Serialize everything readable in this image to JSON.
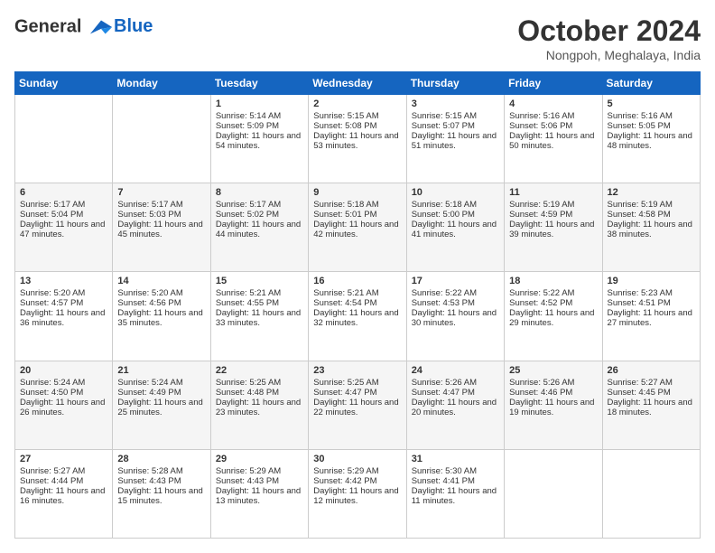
{
  "header": {
    "logo_line1": "General",
    "logo_line2": "Blue",
    "month": "October 2024",
    "location": "Nongpoh, Meghalaya, India"
  },
  "weekdays": [
    "Sunday",
    "Monday",
    "Tuesday",
    "Wednesday",
    "Thursday",
    "Friday",
    "Saturday"
  ],
  "weeks": [
    [
      {
        "day": "",
        "sunrise": "",
        "sunset": "",
        "daylight": ""
      },
      {
        "day": "",
        "sunrise": "",
        "sunset": "",
        "daylight": ""
      },
      {
        "day": "1",
        "sunrise": "Sunrise: 5:14 AM",
        "sunset": "Sunset: 5:09 PM",
        "daylight": "Daylight: 11 hours and 54 minutes."
      },
      {
        "day": "2",
        "sunrise": "Sunrise: 5:15 AM",
        "sunset": "Sunset: 5:08 PM",
        "daylight": "Daylight: 11 hours and 53 minutes."
      },
      {
        "day": "3",
        "sunrise": "Sunrise: 5:15 AM",
        "sunset": "Sunset: 5:07 PM",
        "daylight": "Daylight: 11 hours and 51 minutes."
      },
      {
        "day": "4",
        "sunrise": "Sunrise: 5:16 AM",
        "sunset": "Sunset: 5:06 PM",
        "daylight": "Daylight: 11 hours and 50 minutes."
      },
      {
        "day": "5",
        "sunrise": "Sunrise: 5:16 AM",
        "sunset": "Sunset: 5:05 PM",
        "daylight": "Daylight: 11 hours and 48 minutes."
      }
    ],
    [
      {
        "day": "6",
        "sunrise": "Sunrise: 5:17 AM",
        "sunset": "Sunset: 5:04 PM",
        "daylight": "Daylight: 11 hours and 47 minutes."
      },
      {
        "day": "7",
        "sunrise": "Sunrise: 5:17 AM",
        "sunset": "Sunset: 5:03 PM",
        "daylight": "Daylight: 11 hours and 45 minutes."
      },
      {
        "day": "8",
        "sunrise": "Sunrise: 5:17 AM",
        "sunset": "Sunset: 5:02 PM",
        "daylight": "Daylight: 11 hours and 44 minutes."
      },
      {
        "day": "9",
        "sunrise": "Sunrise: 5:18 AM",
        "sunset": "Sunset: 5:01 PM",
        "daylight": "Daylight: 11 hours and 42 minutes."
      },
      {
        "day": "10",
        "sunrise": "Sunrise: 5:18 AM",
        "sunset": "Sunset: 5:00 PM",
        "daylight": "Daylight: 11 hours and 41 minutes."
      },
      {
        "day": "11",
        "sunrise": "Sunrise: 5:19 AM",
        "sunset": "Sunset: 4:59 PM",
        "daylight": "Daylight: 11 hours and 39 minutes."
      },
      {
        "day": "12",
        "sunrise": "Sunrise: 5:19 AM",
        "sunset": "Sunset: 4:58 PM",
        "daylight": "Daylight: 11 hours and 38 minutes."
      }
    ],
    [
      {
        "day": "13",
        "sunrise": "Sunrise: 5:20 AM",
        "sunset": "Sunset: 4:57 PM",
        "daylight": "Daylight: 11 hours and 36 minutes."
      },
      {
        "day": "14",
        "sunrise": "Sunrise: 5:20 AM",
        "sunset": "Sunset: 4:56 PM",
        "daylight": "Daylight: 11 hours and 35 minutes."
      },
      {
        "day": "15",
        "sunrise": "Sunrise: 5:21 AM",
        "sunset": "Sunset: 4:55 PM",
        "daylight": "Daylight: 11 hours and 33 minutes."
      },
      {
        "day": "16",
        "sunrise": "Sunrise: 5:21 AM",
        "sunset": "Sunset: 4:54 PM",
        "daylight": "Daylight: 11 hours and 32 minutes."
      },
      {
        "day": "17",
        "sunrise": "Sunrise: 5:22 AM",
        "sunset": "Sunset: 4:53 PM",
        "daylight": "Daylight: 11 hours and 30 minutes."
      },
      {
        "day": "18",
        "sunrise": "Sunrise: 5:22 AM",
        "sunset": "Sunset: 4:52 PM",
        "daylight": "Daylight: 11 hours and 29 minutes."
      },
      {
        "day": "19",
        "sunrise": "Sunrise: 5:23 AM",
        "sunset": "Sunset: 4:51 PM",
        "daylight": "Daylight: 11 hours and 27 minutes."
      }
    ],
    [
      {
        "day": "20",
        "sunrise": "Sunrise: 5:24 AM",
        "sunset": "Sunset: 4:50 PM",
        "daylight": "Daylight: 11 hours and 26 minutes."
      },
      {
        "day": "21",
        "sunrise": "Sunrise: 5:24 AM",
        "sunset": "Sunset: 4:49 PM",
        "daylight": "Daylight: 11 hours and 25 minutes."
      },
      {
        "day": "22",
        "sunrise": "Sunrise: 5:25 AM",
        "sunset": "Sunset: 4:48 PM",
        "daylight": "Daylight: 11 hours and 23 minutes."
      },
      {
        "day": "23",
        "sunrise": "Sunrise: 5:25 AM",
        "sunset": "Sunset: 4:47 PM",
        "daylight": "Daylight: 11 hours and 22 minutes."
      },
      {
        "day": "24",
        "sunrise": "Sunrise: 5:26 AM",
        "sunset": "Sunset: 4:47 PM",
        "daylight": "Daylight: 11 hours and 20 minutes."
      },
      {
        "day": "25",
        "sunrise": "Sunrise: 5:26 AM",
        "sunset": "Sunset: 4:46 PM",
        "daylight": "Daylight: 11 hours and 19 minutes."
      },
      {
        "day": "26",
        "sunrise": "Sunrise: 5:27 AM",
        "sunset": "Sunset: 4:45 PM",
        "daylight": "Daylight: 11 hours and 18 minutes."
      }
    ],
    [
      {
        "day": "27",
        "sunrise": "Sunrise: 5:27 AM",
        "sunset": "Sunset: 4:44 PM",
        "daylight": "Daylight: 11 hours and 16 minutes."
      },
      {
        "day": "28",
        "sunrise": "Sunrise: 5:28 AM",
        "sunset": "Sunset: 4:43 PM",
        "daylight": "Daylight: 11 hours and 15 minutes."
      },
      {
        "day": "29",
        "sunrise": "Sunrise: 5:29 AM",
        "sunset": "Sunset: 4:43 PM",
        "daylight": "Daylight: 11 hours and 13 minutes."
      },
      {
        "day": "30",
        "sunrise": "Sunrise: 5:29 AM",
        "sunset": "Sunset: 4:42 PM",
        "daylight": "Daylight: 11 hours and 12 minutes."
      },
      {
        "day": "31",
        "sunrise": "Sunrise: 5:30 AM",
        "sunset": "Sunset: 4:41 PM",
        "daylight": "Daylight: 11 hours and 11 minutes."
      },
      {
        "day": "",
        "sunrise": "",
        "sunset": "",
        "daylight": ""
      },
      {
        "day": "",
        "sunrise": "",
        "sunset": "",
        "daylight": ""
      }
    ]
  ]
}
